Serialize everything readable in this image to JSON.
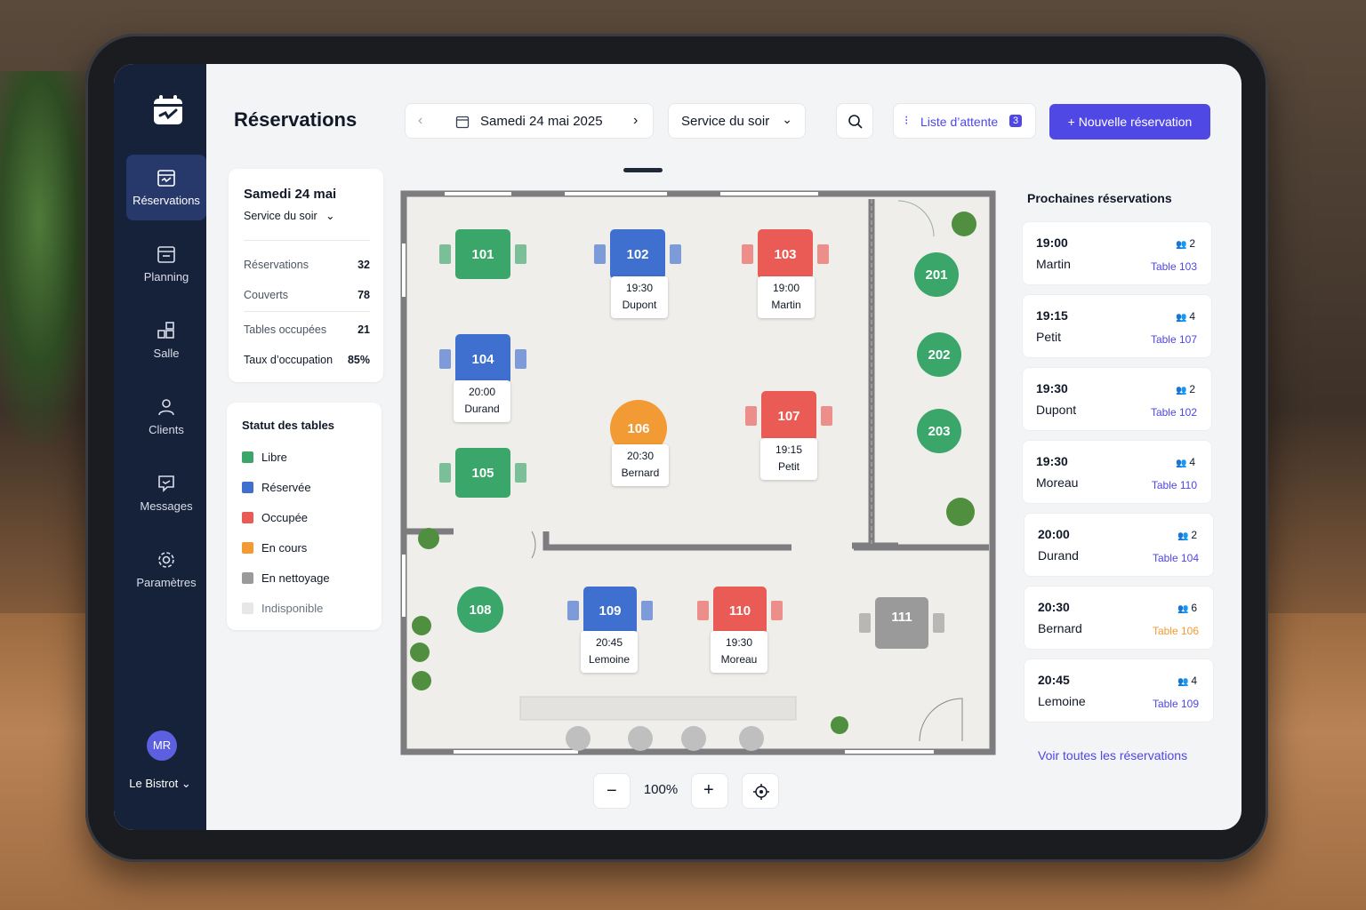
{
  "app": {
    "title": "Réservations",
    "logo": "calendar-logo-icon"
  },
  "sidebar": {
    "items": [
      {
        "label": "Réservations",
        "icon": "calendar-icon",
        "active": true
      },
      {
        "label": "Planning",
        "icon": "planning-icon"
      },
      {
        "label": "Salle",
        "icon": "floor-icon"
      },
      {
        "label": "Clients",
        "icon": "user-icon"
      },
      {
        "label": "Messages",
        "icon": "message-icon"
      },
      {
        "label": "Paramètres",
        "icon": "gear-icon"
      }
    ],
    "user_initials": "MR",
    "venue": "Le Bistrot"
  },
  "header": {
    "date": "Samedi 24 mai 2025",
    "service": "Service du soir",
    "waitlist_label": "Liste d’attente",
    "waitlist_count": "3",
    "new_button": "Nouvelle réservation"
  },
  "summary": {
    "date": "Samedi 24 mai",
    "service": "Service du soir",
    "stats": [
      {
        "label": "Réservations",
        "value": "32"
      },
      {
        "label": "Couverts",
        "value": "78"
      },
      {
        "label": "Tables occupées",
        "value": "21"
      },
      {
        "label": "Taux d’occupation",
        "value": "85%"
      }
    ]
  },
  "status": {
    "title": "Statut des tables",
    "items": [
      {
        "label": "Libre",
        "color": "#3aa66a"
      },
      {
        "label": "Réservée",
        "color": "#3f6fcf"
      },
      {
        "label": "Occupée",
        "color": "#ea5b55"
      },
      {
        "label": "En cours",
        "color": "#f29a33"
      },
      {
        "label": "En nettoyage",
        "color": "#9a9a9a"
      },
      {
        "label": "Indisponible",
        "color": "#e7e7e7"
      }
    ]
  },
  "tables": [
    {
      "num": "101",
      "status": "free"
    },
    {
      "num": "102",
      "status": "reserved",
      "time": "19:30",
      "name": "Dupont"
    },
    {
      "num": "103",
      "status": "occupied",
      "time": "19:00",
      "name": "Martin"
    },
    {
      "num": "104",
      "status": "reserved",
      "time": "20:00",
      "name": "Durand"
    },
    {
      "num": "105",
      "status": "free"
    },
    {
      "num": "106",
      "status": "in_progress",
      "time": "20:30",
      "name": "Bernard"
    },
    {
      "num": "107",
      "status": "occupied",
      "time": "19:15",
      "name": "Petit"
    },
    {
      "num": "108",
      "status": "free"
    },
    {
      "num": "109",
      "status": "reserved",
      "time": "20:45",
      "name": "Lemoine"
    },
    {
      "num": "110",
      "status": "occupied",
      "time": "19:30",
      "name": "Moreau"
    },
    {
      "num": "111",
      "status": "cleaning"
    },
    {
      "num": "201",
      "status": "free"
    },
    {
      "num": "202",
      "status": "free"
    },
    {
      "num": "203",
      "status": "free"
    }
  ],
  "zoom": {
    "level": "100%"
  },
  "upcoming": {
    "title": "Prochaines réservations",
    "items": [
      {
        "time": "19:00",
        "name": "Martin",
        "covers": "2",
        "table": "Table 103"
      },
      {
        "time": "19:15",
        "name": "Petit",
        "covers": "4",
        "table": "Table 107"
      },
      {
        "time": "19:30",
        "name": "Dupont",
        "covers": "2",
        "table": "Table 102"
      },
      {
        "time": "19:30",
        "name": "Moreau",
        "covers": "4",
        "table": "Table 110"
      },
      {
        "time": "20:00",
        "name": "Durand",
        "covers": "2",
        "table": "Table 104"
      },
      {
        "time": "20:30",
        "name": "Bernard",
        "covers": "6",
        "table": "Table 106"
      },
      {
        "time": "20:45",
        "name": "Lemoine",
        "covers": "4",
        "table": "Table 109"
      }
    ],
    "see_all": "Voir toutes les réservations"
  },
  "colors": {
    "free": "#3aa66a",
    "reserved": "#3f6fcf",
    "occupied": "#ea5b55",
    "in_progress": "#f29a33",
    "cleaning": "#9a9a9a",
    "accent": "#5048e5",
    "sidebar": "#16213a"
  }
}
